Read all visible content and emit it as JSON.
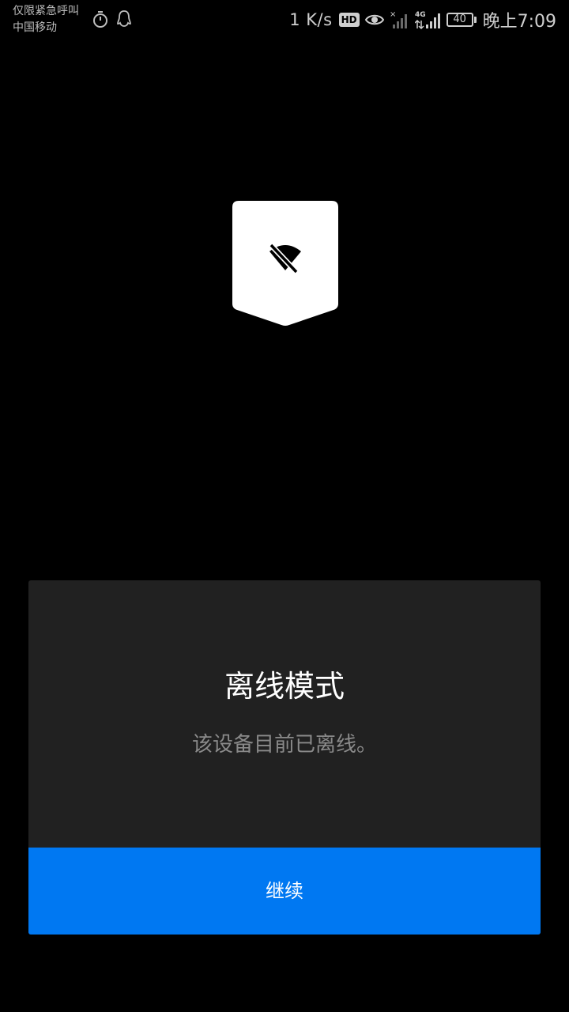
{
  "status_bar": {
    "emergency_text": "仅限紧急呼叫",
    "carrier": "中国移动",
    "net_speed": "1 K/s",
    "hd_label": "HD",
    "network_type": "4G",
    "battery_level": "40",
    "time": "晚上7:09",
    "icons": [
      "timer-icon",
      "qq-icon",
      "eye-icon",
      "signal-icon-sim1",
      "signal-icon-sim2"
    ]
  },
  "offline_badge": {
    "icon": "wifi-off-icon",
    "badge_color": "#ffffff",
    "icon_color": "#000000"
  },
  "dialog": {
    "title": "离线模式",
    "message": "该设备目前已离线。",
    "continue_label": "继续",
    "accent_color": "#0078f2",
    "background_color": "#212121"
  }
}
